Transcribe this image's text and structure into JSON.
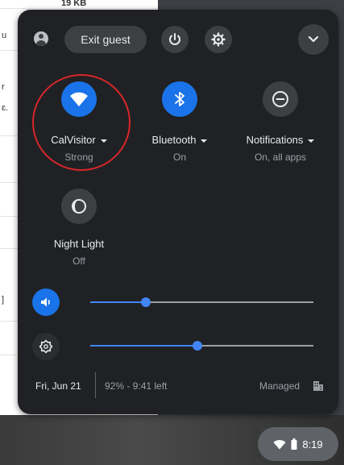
{
  "background": {
    "doc_top_text": "19 KB",
    "doc_fragments": [
      "u",
      "r",
      "ɛ.",
      "]"
    ]
  },
  "header": {
    "exit_guest_label": "Exit guest"
  },
  "tiles": [
    {
      "label": "CalVisitor",
      "status": "Strong",
      "icon": "wifi-icon",
      "active": true,
      "has_dropdown": true
    },
    {
      "label": "Bluetooth",
      "status": "On",
      "icon": "bluetooth-icon",
      "active": true,
      "has_dropdown": true
    },
    {
      "label": "Notifications",
      "status": "On, all apps",
      "icon": "do-not-disturb-icon",
      "active": false,
      "has_dropdown": true
    },
    {
      "label": "Night Light",
      "status": "Off",
      "icon": "night-light-icon",
      "active": false,
      "has_dropdown": false
    }
  ],
  "sliders": {
    "volume": {
      "icon": "volume-icon",
      "value": 0.25
    },
    "brightness": {
      "icon": "brightness-icon",
      "value": 0.48
    }
  },
  "footer": {
    "date": "Fri, Jun 21",
    "battery": "92% - 9:41 left",
    "managed": "Managed"
  },
  "shelf": {
    "time": "8:19"
  },
  "colors": {
    "accent": "#1a73e8",
    "panel_bg": "#202124",
    "highlight": "#d7262b"
  }
}
